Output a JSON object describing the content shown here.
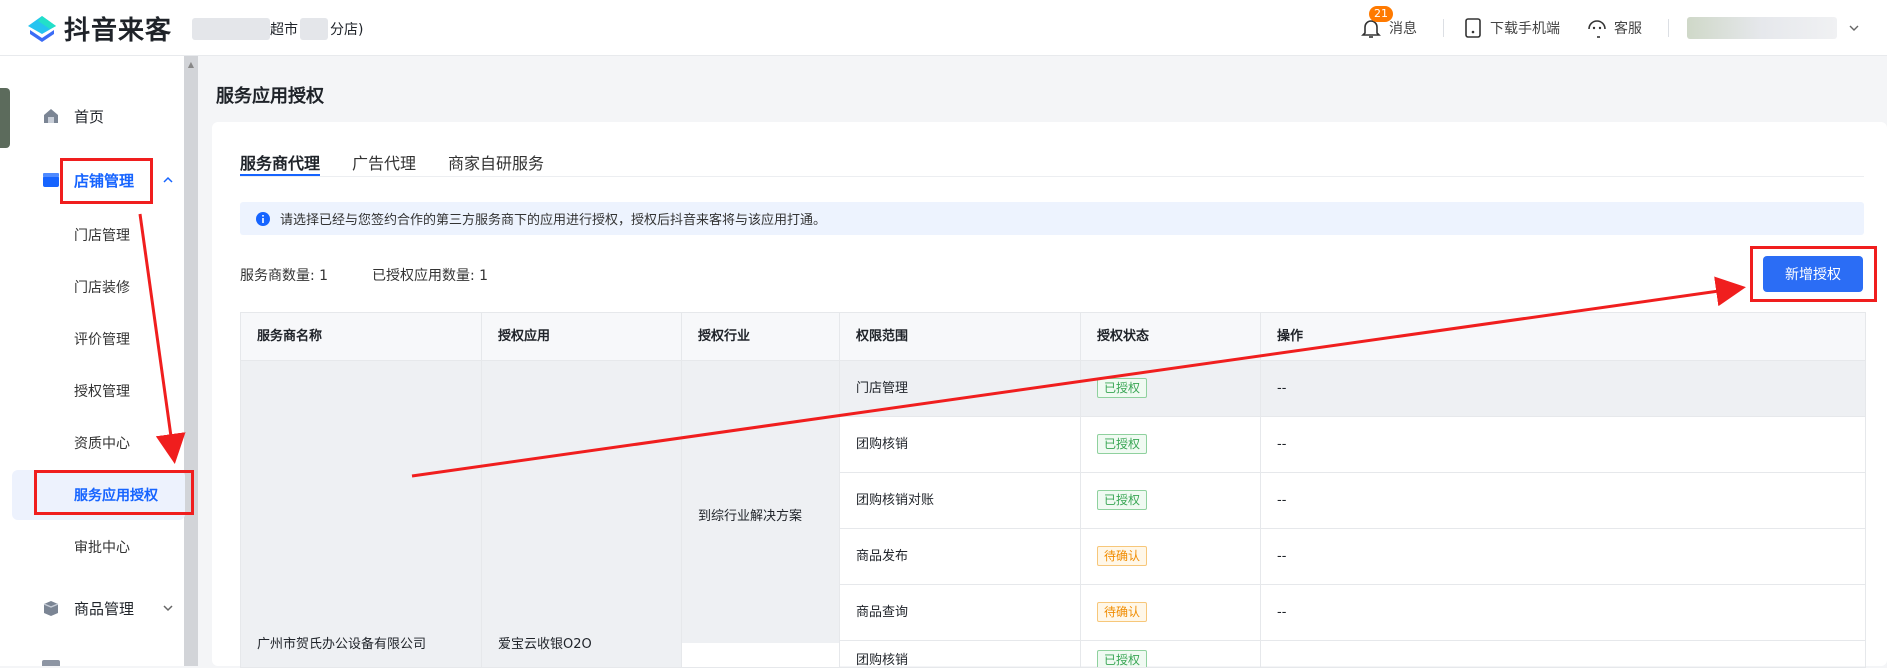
{
  "header": {
    "logo_text": "抖音来客",
    "store_name_visible_1": "超市",
    "store_name_visible_2": "分店)",
    "notifications_badge": "21",
    "messages_label": "消息",
    "download_label": "下载手机端",
    "service_label": "客服"
  },
  "sidebar": {
    "home": "首页",
    "store_mgmt": "店铺管理",
    "store_items": [
      "门店管理",
      "门店装修",
      "评价管理",
      "授权管理",
      "资质中心",
      "服务应用授权",
      "审批中心"
    ],
    "product_mgmt": "商品管理"
  },
  "page": {
    "title": "服务应用授权",
    "tabs": [
      "服务商代理",
      "广告代理",
      "商家自研服务"
    ],
    "notice": "请选择已经与您签约合作的第三方服务商下的应用进行授权，授权后抖音来客将与该应用打通。",
    "provider_count": "服务商数量: 1",
    "authorized_count": "已授权应用数量: 1",
    "add_button": "新增授权"
  },
  "table": {
    "headers": [
      "服务商名称",
      "授权应用",
      "授权行业",
      "权限范围",
      "授权状态",
      "操作"
    ],
    "provider": "广州市贺氏办公设备有限公司",
    "app": "爱宝云收银O2O",
    "industry": "到综行业解决方案",
    "rows": [
      {
        "scope": "门店管理",
        "status": "已授权",
        "action": "--"
      },
      {
        "scope": "团购核销",
        "status": "已授权",
        "action": "--"
      },
      {
        "scope": "团购核销对账",
        "status": "已授权",
        "action": "--"
      },
      {
        "scope": "商品发布",
        "status": "待确认",
        "action": "--"
      },
      {
        "scope": "商品查询",
        "status": "待确认",
        "action": "--"
      },
      {
        "scope": "团购核销",
        "status": "已授权",
        "action": ""
      }
    ]
  },
  "colors": {
    "accent": "#1664ff",
    "button": "#2b6df5",
    "annotation_red": "#f01e1e",
    "status_ok": "#3aa655",
    "status_wait": "#f08c00"
  }
}
